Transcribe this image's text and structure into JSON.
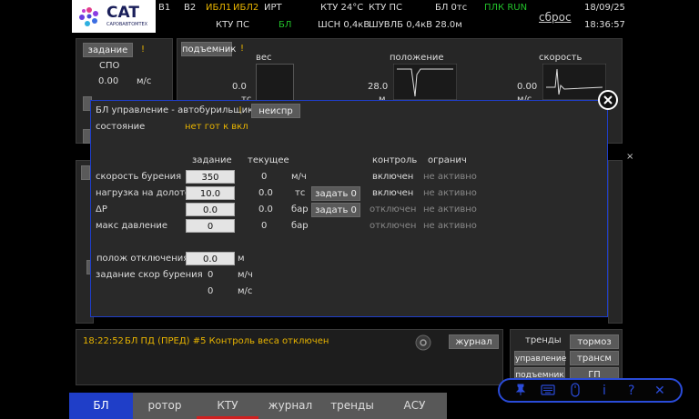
{
  "header": {
    "logo_title": "CAT",
    "logo_sub": "САРОВАВТОМТЕХ",
    "row1": [
      "В1",
      "В2",
      "ИБЛ1",
      "ИБЛ2",
      "ИРТ",
      "КТУ 24°C",
      "КТУ ПС",
      "БЛ 0тс",
      "ПЛК RUN"
    ],
    "row2": [
      "КТУ ПС",
      "БЛ",
      "ШСН 0,4кВ",
      "ШУВЛБ 0,4кВ",
      "28.0м"
    ],
    "reset": "сброс",
    "date": "18/09/25",
    "time": "18:36:57"
  },
  "bg": {
    "task_btn": "задание",
    "task_mark": "!",
    "spo": "СПО",
    "spo_value": "0.00",
    "spo_unit": "м/с",
    "lift_btn": "подъемник",
    "lift_mark": "!",
    "ves": "вес",
    "polozhenie": "положение",
    "skorost": "скорость",
    "ves_value": "0.0",
    "ves_unit": "тс",
    "pos_value": "28.0",
    "pos_unit": "м",
    "speed_value": "0.00",
    "speed_unit": "м/с"
  },
  "dialog": {
    "title": "БЛ управление - автобурильщик",
    "title_mark": "!",
    "fault_btn": "неиспр",
    "state_label": "состояние",
    "state_value": "нет гот к вкл",
    "col_task": "задание",
    "col_current": "текущее",
    "col_control": "контроль",
    "col_limit": "огранич",
    "rows": [
      {
        "label": "скорость бурения",
        "task": "350",
        "current": "0",
        "unit": "м/ч",
        "button": "",
        "control": "включен",
        "limit": "не активно"
      },
      {
        "label": "нагрузка на долото",
        "task": "10.0",
        "current": "0.0",
        "unit": "тс",
        "button": "задать 0",
        "control": "включен",
        "limit": "не активно"
      },
      {
        "label": "ΔP",
        "task": "0.0",
        "current": "0.0",
        "unit": "бар",
        "button": "задать 0",
        "control": "отключен",
        "limit": "не активно"
      },
      {
        "label": "макс давление",
        "task": "0",
        "current": "0",
        "unit": "бар",
        "button": "",
        "control": "отключен",
        "limit": "не активно"
      }
    ],
    "cutoff_label": "полож отключения",
    "cutoff_value": "0.0",
    "cutoff_unit": "м",
    "rate_label": "задание скор бурения",
    "rate_value1": "0",
    "rate_unit1": "м/ч",
    "rate_value2": "0",
    "rate_unit2": "м/с"
  },
  "log": {
    "time": "18:22:52",
    "message": "БЛ ПД (ПРЕД) #5 Контроль веса отключен",
    "journal_btn": "журнал"
  },
  "side": {
    "trends": "тренды",
    "brake": "тормоз",
    "control": "управление",
    "transm": "трансм",
    "lift": "подъемник",
    "gp": "ГП"
  },
  "tabs": [
    "БЛ",
    "ротор",
    "КТУ",
    "журнал",
    "тренды",
    "АСУ"
  ],
  "toolbar": {
    "info": "i",
    "help": "?",
    "close": "✕"
  },
  "colors": {
    "accent_blue": "#1f3ec8",
    "warning": "#e8b400",
    "ok_green": "#22c02a"
  }
}
